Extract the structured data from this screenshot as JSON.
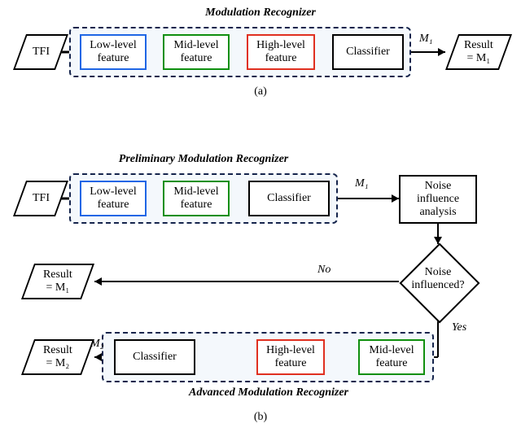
{
  "a": {
    "title": "Modulation Recognizer",
    "input": "TFI",
    "low": "Low-level\nfeature",
    "mid": "Mid-level\nfeature",
    "high": "High-level\nfeature",
    "classifier": "Classifier",
    "m1": "M₁",
    "result": "Result\n= M₁",
    "caption": "(a)"
  },
  "b": {
    "title_pre": "Preliminary Modulation Recognizer",
    "title_adv": "Advanced Modulation Recognizer",
    "input": "TFI",
    "low": "Low-level\nfeature",
    "mid": "Mid-level\nfeature",
    "classifier": "Classifier",
    "classifier2": "Classifier",
    "m1": "M₁",
    "m2": "M₂",
    "noise_analysis": "Noise\ninfluence\nanalysis",
    "noise_decision": "Noise\ninfluenced?",
    "no": "No",
    "yes": "Yes",
    "high": "High-level\nfeature",
    "mid2": "Mid-level\nfeature",
    "result_m1": "Result\n= M₁",
    "result_m2": "Result\n= M₂",
    "caption": "(b)"
  }
}
